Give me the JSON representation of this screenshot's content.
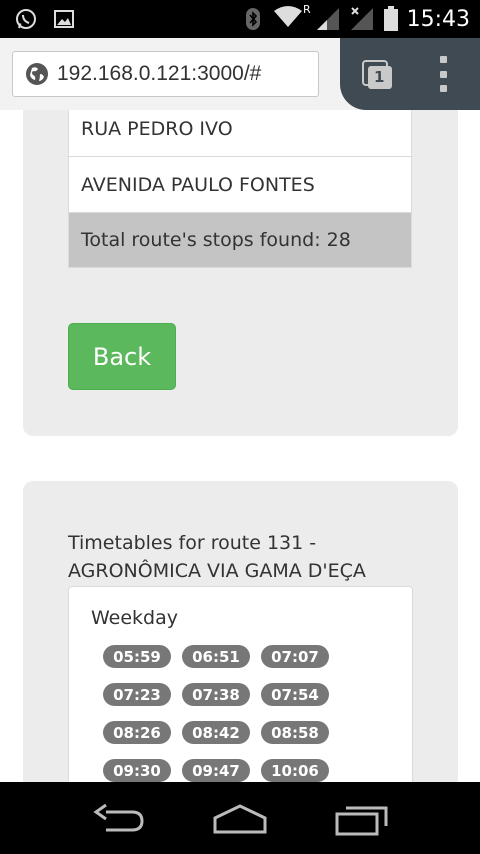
{
  "status_bar": {
    "time": "15:43",
    "roaming_indicator": "R",
    "icons": [
      "whatsapp-icon",
      "image-icon",
      "bluetooth-icon",
      "wifi-icon",
      "signal-icon",
      "signal-no-sim-icon",
      "battery-icon"
    ]
  },
  "browser": {
    "url": "192.168.0.121:3000/#",
    "tab_count": "1",
    "icons": [
      "globe-icon",
      "tabs-icon",
      "overflow-menu-icon"
    ]
  },
  "stops": {
    "items": [
      "RUA PEDRO IVO",
      "AVENIDA PAULO FONTES"
    ],
    "total_label": "Total route's stops found: 28"
  },
  "back_button": {
    "label": "Back",
    "color": "#5cb85c"
  },
  "timetable": {
    "title": "Timetables for route 131 - AGRONÔMICA VIA GAMA D'EÇA",
    "day_label": "Weekday",
    "times": [
      "05:59",
      "06:51",
      "07:07",
      "07:23",
      "07:38",
      "07:54",
      "08:26",
      "08:42",
      "08:58",
      "09:30",
      "09:47",
      "10:06"
    ]
  },
  "nav_bar": {
    "icons": [
      "back-arrow-icon",
      "home-icon",
      "recent-apps-icon"
    ]
  }
}
